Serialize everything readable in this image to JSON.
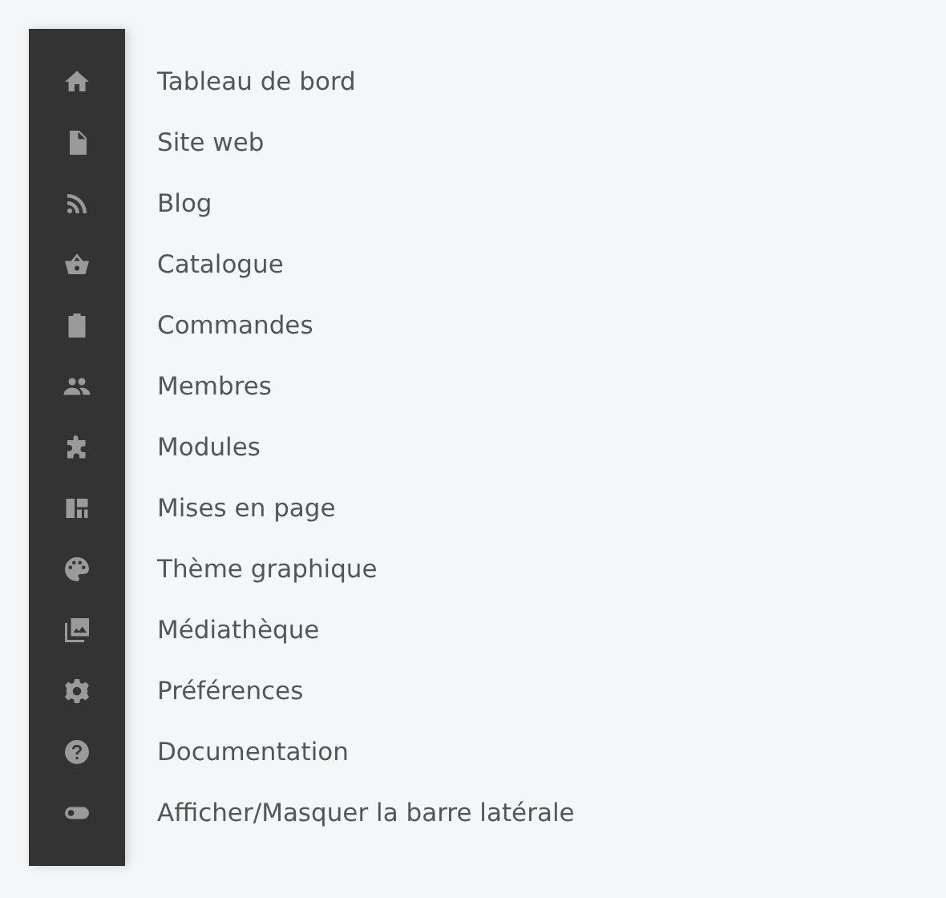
{
  "menu": [
    {
      "label": "Tableau de bord"
    },
    {
      "label": "Site web"
    },
    {
      "label": "Blog"
    },
    {
      "label": "Catalogue"
    },
    {
      "label": "Commandes"
    },
    {
      "label": "Membres"
    },
    {
      "label": "Modules"
    },
    {
      "label": "Mises en page"
    },
    {
      "label": "Thème graphique"
    },
    {
      "label": "Médiathèque"
    },
    {
      "label": "Préférences"
    },
    {
      "label": "Documentation"
    },
    {
      "label": "Afficher/Masquer la barre latérale"
    }
  ]
}
